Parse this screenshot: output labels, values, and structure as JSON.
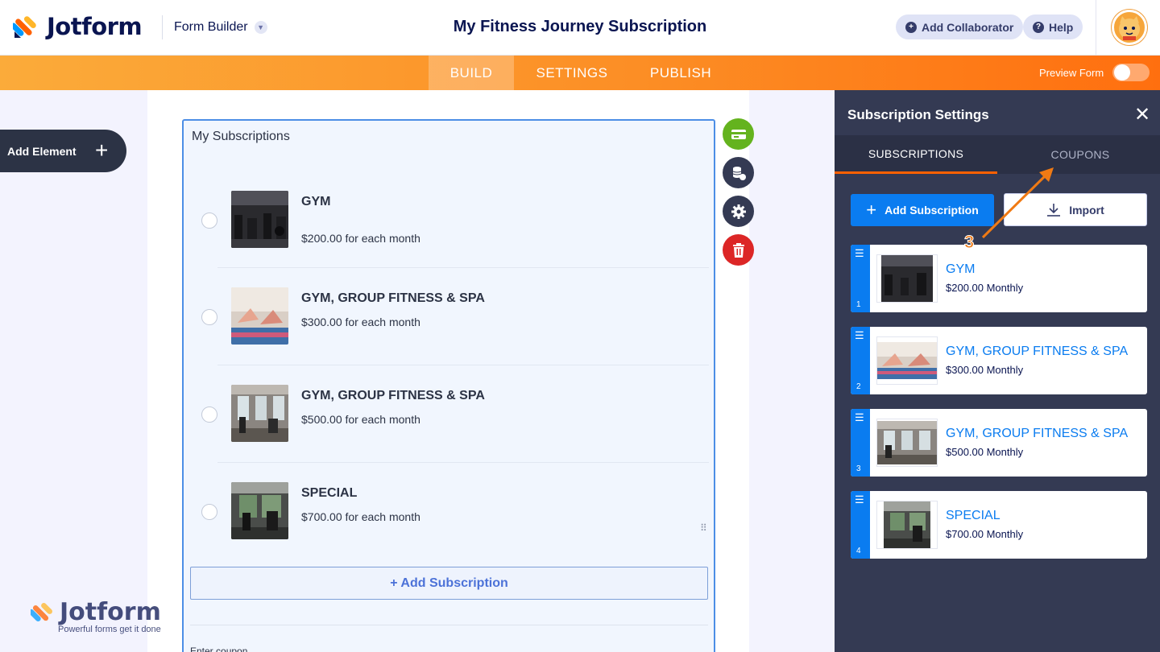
{
  "header": {
    "logo_text": "Jotform",
    "builder_label": "Form Builder",
    "form_title": "My Fitness Journey Subscription",
    "add_collaborator": "Add Collaborator",
    "help": "Help"
  },
  "nav": {
    "tabs": [
      {
        "label": "BUILD",
        "active": true
      },
      {
        "label": "SETTINGS",
        "active": false
      },
      {
        "label": "PUBLISH",
        "active": false
      }
    ],
    "preview_label": "Preview Form",
    "preview_on": false
  },
  "left": {
    "add_element": "Add Element"
  },
  "form": {
    "field_title": "My Subscriptions",
    "items": [
      {
        "name": "GYM",
        "price": "$200.00 for each month"
      },
      {
        "name": "GYM, GROUP FITNESS & SPA",
        "price": "$300.00 for each month"
      },
      {
        "name": "GYM, GROUP FITNESS & SPA",
        "price": "$500.00 for each month"
      },
      {
        "name": "SPECIAL",
        "price": "$700.00 for each month"
      }
    ],
    "add_subscription": "+ Add Subscription",
    "coupon_label": "Enter coupon"
  },
  "panel": {
    "title": "Subscription Settings",
    "tabs": [
      {
        "label": "SUBSCRIPTIONS",
        "active": true
      },
      {
        "label": "COUPONS",
        "active": false
      }
    ],
    "add_button": "Add Subscription",
    "import_button": "Import",
    "items": [
      {
        "index": "1",
        "name": "GYM",
        "price": "$200.00 Monthly"
      },
      {
        "index": "2",
        "name": "GYM, GROUP FITNESS & SPA",
        "price": "$300.00 Monthly"
      },
      {
        "index": "3",
        "name": "GYM, GROUP FITNESS & SPA",
        "price": "$500.00 Monthly"
      },
      {
        "index": "4",
        "name": "SPECIAL",
        "price": "$700.00 Monthly"
      }
    ]
  },
  "annotation": {
    "step": "3"
  },
  "watermark": {
    "text": "Jotform",
    "tagline": "Powerful forms get it done"
  },
  "colors": {
    "accent_blue": "#0a7cf0",
    "nav_orange": "#fc8e25",
    "panel_bg": "#343a53",
    "delete_red": "#dc2626",
    "payment_green": "#64b31e"
  }
}
